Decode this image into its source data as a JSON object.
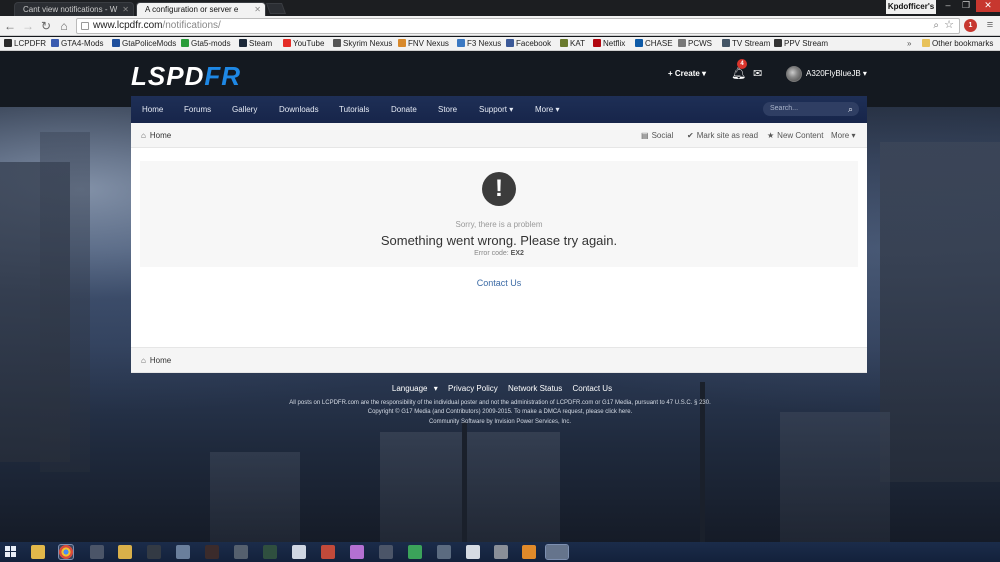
{
  "browser": {
    "tabs": [
      {
        "title": "Cant view notifications - W",
        "active": false
      },
      {
        "title": "A configuration or server e",
        "active": true
      }
    ],
    "profile": "Kpdofficer's",
    "url_host": "www.lcpdfr.com",
    "url_path": "/notifications/",
    "extension_badge": "1",
    "bookmarks": [
      {
        "label": "LCPDFR",
        "color": "#2a2a2a"
      },
      {
        "label": "GTA4-Mods",
        "color": "#3a5bb0"
      },
      {
        "label": "GtaPoliceMods",
        "color": "#1f4f9c"
      },
      {
        "label": "Gta5-mods",
        "color": "#2a9d3a"
      },
      {
        "label": "Steam",
        "color": "#1b2838"
      },
      {
        "label": "YouTube",
        "color": "#e52d27"
      },
      {
        "label": "Skyrim Nexus",
        "color": "#555555"
      },
      {
        "label": "FNV Nexus",
        "color": "#d8892b"
      },
      {
        "label": "F3 Nexus",
        "color": "#3a78c2"
      },
      {
        "label": "Facebook",
        "color": "#3b5998"
      },
      {
        "label": "KAT",
        "color": "#6b7b2e"
      },
      {
        "label": "Netflix",
        "color": "#b20710"
      },
      {
        "label": "CHASE",
        "color": "#0d5aa7"
      },
      {
        "label": "PCWS",
        "color": "#777777"
      },
      {
        "label": "TV Stream",
        "color": "#445566"
      },
      {
        "label": "PPV Stream",
        "color": "#333333"
      }
    ],
    "overflow": "»",
    "other_bookmarks": "Other bookmarks"
  },
  "site": {
    "logo_a": "LSPD",
    "logo_b": "FR",
    "create_label": "Create",
    "notification_count": "4",
    "username": "A320FlyBlueJB",
    "nav": [
      "Home",
      "Forums",
      "Gallery",
      "Downloads",
      "Tutorials",
      "Donate",
      "Store",
      "Support",
      "More"
    ],
    "search_placeholder": "Search...",
    "breadcrumb_home": "Home",
    "actions": {
      "social": "Social",
      "mark_read": "Mark site as read",
      "new_content": "New Content",
      "more": "More"
    },
    "error": {
      "sub": "Sorry, there is a problem",
      "main": "Something went wrong. Please try again.",
      "code_label": "Error code:",
      "code": "EX2"
    },
    "contact": "Contact Us",
    "footer_links": [
      "Language",
      "Privacy Policy",
      "Network Status",
      "Contact Us"
    ],
    "footer_lines": [
      "All posts on LCPDFR.com are the responsibility of the individual poster and not the administration of LCPDFR.com or G17 Media, pursuant to 47 U.S.C. § 230.",
      "Copyright © G17 Media (and Contributors) 2009-2015. To make a DMCA request, please click here.",
      "Community Software by Invision Power Services, Inc."
    ]
  },
  "taskbar": {
    "icons": [
      "start-menu",
      "file-explorer",
      "chrome",
      "mixer",
      "folder",
      "media",
      "mail",
      "game",
      "app",
      "system",
      "browser",
      "app-purple",
      "tool",
      "green-app",
      "disc",
      "steam",
      "task-manager",
      "cmd",
      "app-window"
    ],
    "active_icon": "chrome"
  },
  "colors": {
    "accent": "#1e88e5",
    "nav_bg": "#1e2f56",
    "link": "#3b6aa5",
    "badge": "#d9342b"
  }
}
